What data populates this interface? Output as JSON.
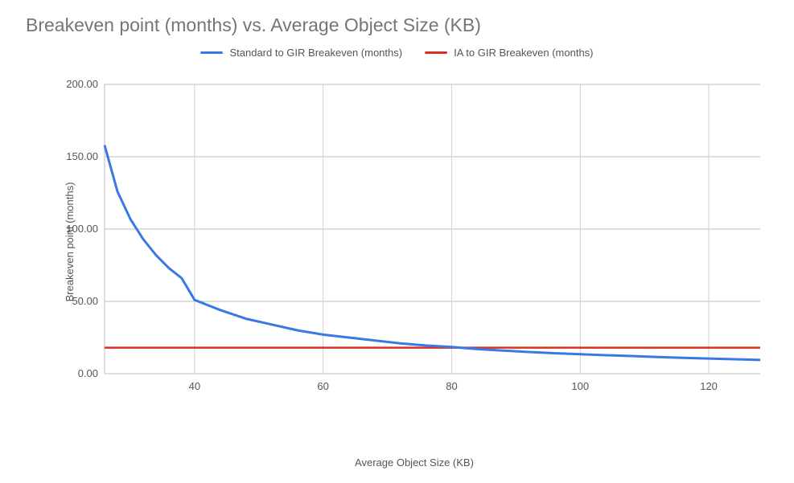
{
  "chart_data": {
    "type": "line",
    "title": "Breakeven point (months) vs. Average Object Size (KB)",
    "xlabel": "Average Object Size (KB)",
    "ylabel": "Breakeven point (months)",
    "xlim": [
      26,
      128
    ],
    "ylim": [
      0,
      200
    ],
    "x_ticks": [
      40,
      60,
      80,
      100,
      120
    ],
    "y_ticks": [
      0.0,
      50.0,
      100.0,
      150.0,
      200.0
    ],
    "y_tick_labels": [
      "0.00",
      "50.00",
      "100.00",
      "150.00",
      "200.00"
    ],
    "series": [
      {
        "name": "Standard to GIR Breakeven (months)",
        "color": "#3b78e7",
        "x": [
          26,
          28,
          30,
          32,
          34,
          36,
          38,
          40,
          44,
          48,
          52,
          56,
          60,
          64,
          68,
          72,
          76,
          80,
          84,
          88,
          92,
          96,
          100,
          104,
          108,
          112,
          116,
          120,
          124,
          128
        ],
        "y": [
          158,
          126,
          107,
          93,
          82,
          73,
          66,
          51,
          44,
          38,
          34,
          30,
          27,
          25,
          23,
          21,
          19.5,
          18.5,
          17,
          16,
          15,
          14.2,
          13.5,
          12.8,
          12.2,
          11.5,
          11,
          10.5,
          10,
          9.5
        ]
      },
      {
        "name": "IA to GIR Breakeven (months)",
        "color": "#d93025",
        "x": [
          26,
          128
        ],
        "y": [
          18,
          18
        ]
      }
    ],
    "legend": {
      "position": "top",
      "items": [
        {
          "label": "Standard to GIR Breakeven (months)",
          "color": "#3b78e7"
        },
        {
          "label": "IA to GIR Breakeven (months)",
          "color": "#d93025"
        }
      ]
    }
  }
}
